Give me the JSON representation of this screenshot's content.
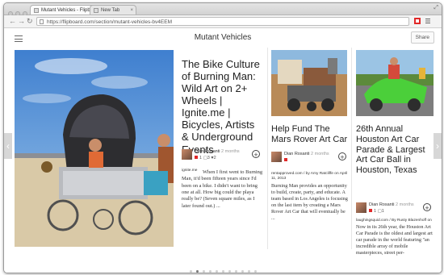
{
  "browser": {
    "tabs": [
      {
        "label": "Mutant Vehicles - Flipbo..."
      },
      {
        "label": "New Tab"
      }
    ],
    "url": "https://flipboard.com/section/mutant-vehicles-bv4EEM"
  },
  "header": {
    "title": "Mutant Vehicles",
    "share_label": "Share"
  },
  "articles": [
    {
      "title": "The Bike Culture of Burning Man: Wild Art on 2+ Wheels | Ignite.me | Bicycles, Artists & Underground Events",
      "author": "Dian Rosanti",
      "time": "2 months",
      "likes": "1",
      "comments": "3",
      "hearts": "2",
      "source": "ignite.me",
      "excerpt": "When I first went to Burning Man, it'd been fifteen years since I'd been on a bike. I didn't want to bring one at all. How big could the playa really be? (Seven square miles, as I later found out.) ..."
    },
    {
      "title": "Help Fund The Mars Rover Art Car",
      "author": "Dian Rosanti",
      "time": "2 months",
      "source": "rentapproved.com / by Amy Ratcliffe on April 11, 2013",
      "excerpt": "Burning Man provides an opportunity to build, create, party, and educate. A team based in Los Angeles is focusing on the last item by creating a Mars Rover Art Car that will eventually be ..."
    },
    {
      "title": "26th Annual Houston Art Car Parade & Largest Art Car Ball in Houston, Texas",
      "author": "Dian Rosanti",
      "time": "2 months",
      "likes": "1",
      "comments": "1",
      "source": "laughingsquid.com / By Rusty Blazenhoff on",
      "excerpt": "Now in its 26th year, the Houston Art Car Parade is the oldest and largest art car parade in the world featuring \"an incredible array of mobile masterpieces, street per-"
    }
  ],
  "pagination": {
    "total": 11,
    "active": 1
  },
  "icons": [
    "back-icon",
    "forward-icon",
    "reload-icon",
    "hamburger-icon",
    "plus-icon",
    "chevron-left-icon",
    "chevron-right-icon"
  ]
}
